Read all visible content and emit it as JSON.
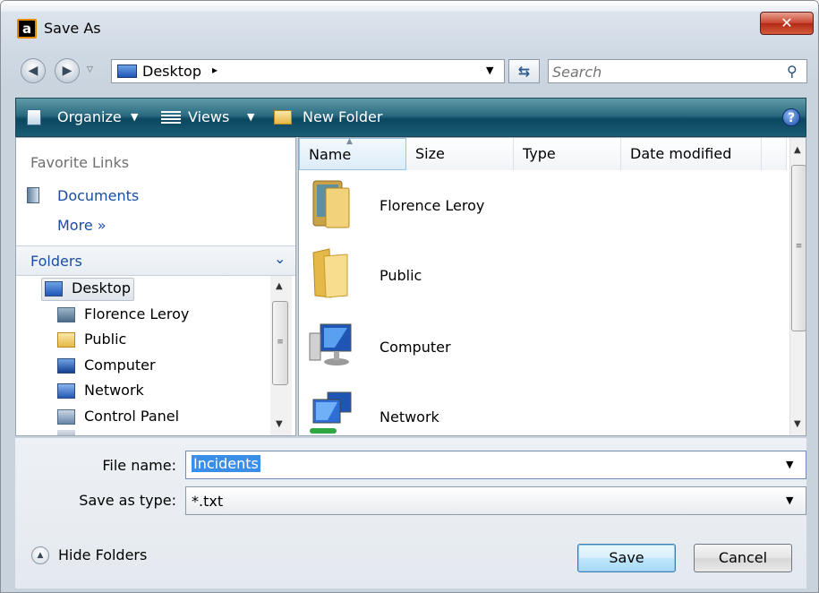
{
  "window": {
    "title": "Save As",
    "app_icon_letter": "a",
    "close_symbol": "✕"
  },
  "nav": {
    "back_symbol": "◀",
    "forward_symbol": "▶",
    "dropdown_symbol": "▽",
    "address": {
      "location": "Desktop",
      "arrow": "▸",
      "dropdown": "▼"
    },
    "refresh_symbol": "⇆",
    "search": {
      "placeholder": "Search",
      "icon": "search-icon",
      "icon_glyph": "⚲"
    }
  },
  "toolbar": {
    "organize_label": "Organize",
    "views_label": "Views",
    "new_folder_label": "New Folder",
    "dropdown": "▼",
    "help_symbol": "?"
  },
  "left_pane": {
    "favorite_links_title": "Favorite Links",
    "documents_label": "Documents",
    "more_label": "More »",
    "folders_title": "Folders",
    "folders_chevron": "⌄",
    "tree": [
      {
        "label": "Desktop",
        "icon": "desktop-icon",
        "selected": true
      },
      {
        "label": "Florence Leroy",
        "icon": "user-folder-icon"
      },
      {
        "label": "Public",
        "icon": "folder-icon"
      },
      {
        "label": "Computer",
        "icon": "computer-icon"
      },
      {
        "label": "Network",
        "icon": "network-icon"
      },
      {
        "label": "Control Panel",
        "icon": "control-panel-icon"
      }
    ],
    "scroll_up": "▲",
    "scroll_down": "▼",
    "scroll_grip": "≡"
  },
  "file_list": {
    "columns": [
      "Name",
      "Size",
      "Type",
      "Date modified"
    ],
    "sort_indicator": "▲",
    "items": [
      {
        "label": "Florence Leroy",
        "icon": "user-folder-icon"
      },
      {
        "label": "Public",
        "icon": "folder-icon"
      },
      {
        "label": "Computer",
        "icon": "computer-icon"
      },
      {
        "label": "Network",
        "icon": "network-icon"
      }
    ],
    "scroll_up": "▲",
    "scroll_down": "▼",
    "scroll_grip": "≡"
  },
  "bottom": {
    "file_name_label": "File name:",
    "file_name_value": "Incidents",
    "save_as_type_label": "Save as type:",
    "save_as_type_value": "*.txt",
    "dropdown": "▼",
    "hide_folders_label": "Hide Folders",
    "hide_folders_symbol": "▲",
    "save_label": "Save",
    "cancel_label": "Cancel"
  },
  "colors": {
    "toolbar": "#1a5d73",
    "link": "#1a4da3",
    "selection": "#3b8ee8",
    "close": "#c8432f"
  }
}
